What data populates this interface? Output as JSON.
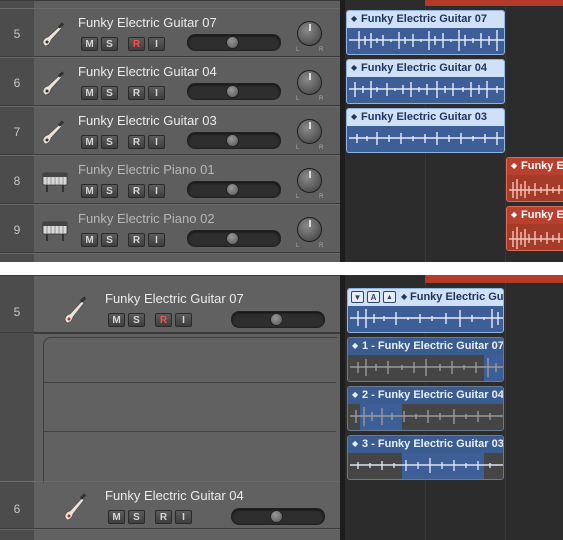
{
  "top_tracks": [
    {
      "num": "5",
      "name": "Funky Electric Guitar 07",
      "icon": "guitar-icon",
      "record_armed": true
    },
    {
      "num": "6",
      "name": "Funky Electric Guitar 04",
      "icon": "guitar-icon",
      "record_armed": false
    },
    {
      "num": "7",
      "name": "Funky Electric Guitar 03",
      "icon": "guitar-icon",
      "record_armed": false
    },
    {
      "num": "8",
      "name": "Funky Electric Piano 01",
      "icon": "electric-piano-icon",
      "record_armed": false
    },
    {
      "num": "9",
      "name": "Funky Electric Piano 02",
      "icon": "electric-piano-icon",
      "record_armed": false
    }
  ],
  "buttons": {
    "mute": "M",
    "solo": "S",
    "record": "R",
    "input": "I"
  },
  "pan": {
    "left": "L",
    "right": "R"
  },
  "top_regions": [
    {
      "label": "Funky Electric Guitar 07",
      "color": "blue"
    },
    {
      "label": "Funky Electric Guitar 04",
      "color": "blue"
    },
    {
      "label": "Funky Electric Guitar 03",
      "color": "blue"
    },
    {
      "label": "Funky El",
      "color": "red"
    },
    {
      "label": "Funky El",
      "color": "red"
    }
  ],
  "bottom_tracks": [
    {
      "num": "5",
      "name": "Funky Electric Guitar 07",
      "icon": "guitar-icon",
      "record_armed": true
    },
    {
      "num": "6",
      "name": "Funky Electric Guitar 04",
      "icon": "guitar-icon",
      "record_armed": false
    }
  ],
  "take_folder": {
    "folder_label": "Funky Electric Gu",
    "menu_icon": "triangle-down-icon",
    "quick_swipe": "A",
    "takes": [
      "1 - Funky Electric Guitar 07",
      "2 - Funky Electric Guitar 04",
      "3 - Funky Electric Guitar 03"
    ]
  },
  "colors": {
    "region_blue": "#3d5e97",
    "region_header": "#cfe0f7",
    "region_red": "#a53c2a",
    "record": "#ff4c4c"
  }
}
